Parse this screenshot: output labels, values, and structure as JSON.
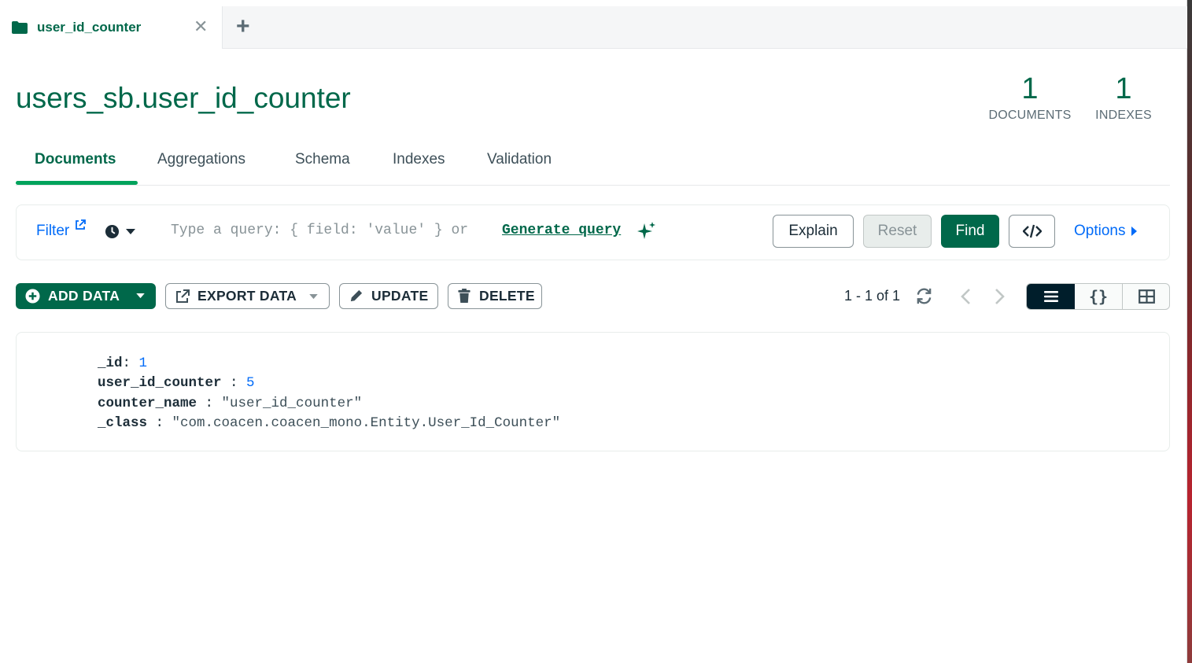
{
  "tab": {
    "title": "user_id_counter",
    "close_label": "✕",
    "add_label": "+"
  },
  "header": {
    "namespace": "users_sb.user_id_counter",
    "documents_count": "1",
    "documents_label": "DOCUMENTS",
    "indexes_count": "1",
    "indexes_label": "INDEXES"
  },
  "subtabs": [
    "Documents",
    "Aggregations",
    "Schema",
    "Indexes",
    "Validation"
  ],
  "query": {
    "filter_label": "Filter",
    "placeholder": "Type a query: { field: 'value' } or ",
    "generate_label": "Generate query",
    "explain_label": "Explain",
    "reset_label": "Reset",
    "find_label": "Find",
    "options_label": "Options"
  },
  "actions": {
    "add_data": "ADD DATA",
    "export_data": "EXPORT DATA",
    "update": "UPDATE",
    "delete": "DELETE"
  },
  "pagination": {
    "text": "1 - 1 of 1"
  },
  "colors": {
    "brand_green": "#00684a",
    "accent_green": "#00a35c",
    "link_blue": "#016bf8",
    "dark": "#001e2b"
  },
  "document": {
    "fields": [
      {
        "key": "_id",
        "sep": ": ",
        "value": "1",
        "type": "number"
      },
      {
        "key": "user_id_counter",
        "sep": " : ",
        "value": "5",
        "type": "number"
      },
      {
        "key": "counter_name",
        "sep": " : ",
        "value": "\"user_id_counter\"",
        "type": "string"
      },
      {
        "key": "_class",
        "sep": " : ",
        "value": "\"com.coacen.coacen_mono.Entity.User_Id_Counter\"",
        "type": "string"
      }
    ]
  }
}
